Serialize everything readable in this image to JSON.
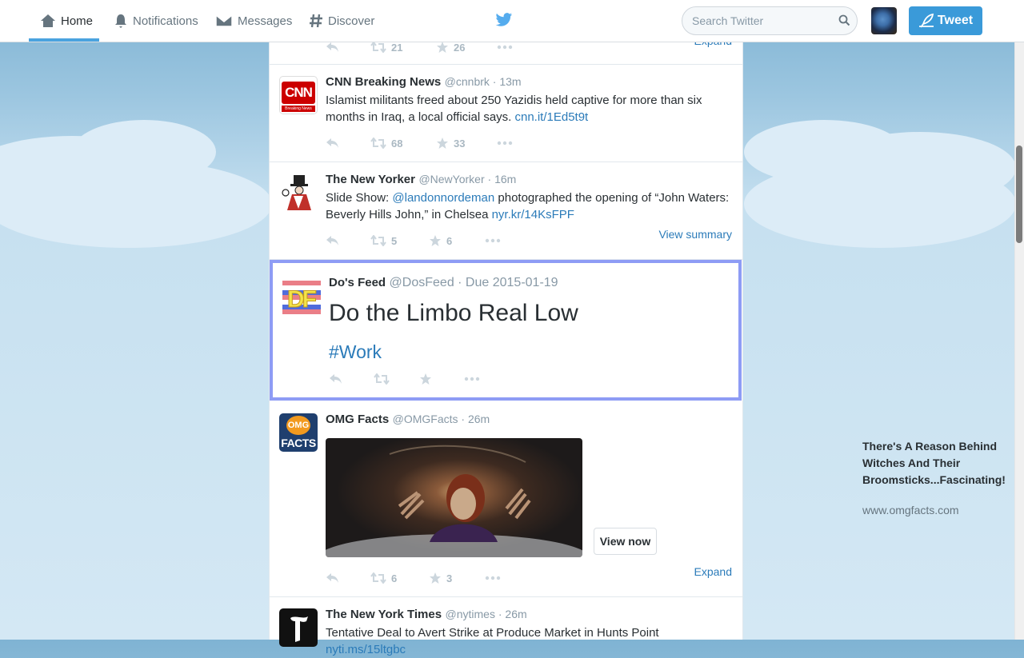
{
  "nav": {
    "home": "Home",
    "notifications": "Notifications",
    "messages": "Messages",
    "discover": "Discover",
    "active": "Home"
  },
  "search": {
    "placeholder": "Search Twitter"
  },
  "tweet_button": "Tweet",
  "colors": {
    "accent": "#3a9ad9",
    "link": "#2b7bb9",
    "highlight_border": "#8e9cf5"
  },
  "timeline": {
    "partial_top": {
      "retweets": "21",
      "favorites": "26",
      "expand": "Expand"
    },
    "tweets": [
      {
        "name": "CNN Breaking News",
        "meta": "@cnnbrk · 13m",
        "text": "Islamist militants freed about 250 Yazidis held captive for more than six months in Iraq, a local official says. ",
        "link": "cnn.it/1Ed5t9t",
        "retweets": "68",
        "favorites": "33",
        "avatar_text": "CNN",
        "avatar_sub": "Breaking News"
      },
      {
        "name": "The New Yorker",
        "meta": "@NewYorker · 16m",
        "text_a": "Slide Show: ",
        "mention": "@landonnordeman",
        "text_b": " photographed the opening of “John Waters: Beverly Hills John,” in Chelsea ",
        "link": "nyr.kr/14KsFPF",
        "retweets": "5",
        "favorites": "6",
        "right_link": "View summary"
      },
      {
        "name": "Do's Feed",
        "meta": "@DosFeed · Due 2015-01-19",
        "title": "Do the Limbo Real Low",
        "hashtag": "#Work",
        "avatar_text": "DF"
      },
      {
        "name": "OMG Facts",
        "meta": "@OMGFacts · 26m",
        "avatar_top": "OMG",
        "avatar_bottom": "FACTS",
        "card_title": "There's A Reason Behind Witches And Their Broomsticks...Fascinating!",
        "card_domain": "www.omgfacts.com",
        "card_button": "View now",
        "retweets": "6",
        "favorites": "3",
        "right_link": "Expand"
      },
      {
        "name": "The New York Times",
        "meta": "@nytimes · 26m",
        "text": "Tentative Deal to Avert Strike at Produce Market in Hunts Point ",
        "link": "nyti.ms/15ltgbc"
      }
    ]
  }
}
